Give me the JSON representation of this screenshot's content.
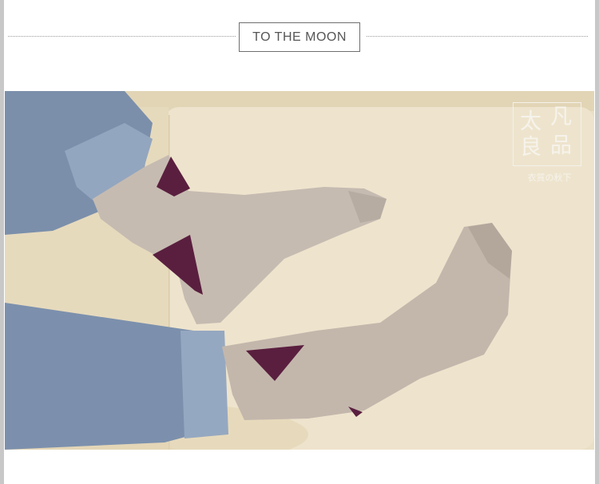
{
  "header": {
    "title": "TO THE MOON"
  },
  "logo": {
    "chars": [
      "太",
      "凡",
      "良",
      "品"
    ],
    "tagline": "衣質の秋下"
  },
  "colors": {
    "sofa": "#e8dcc0",
    "jeans": "#7f93ae",
    "sock": "#c9bdb2",
    "argyle": "#5a1f3f"
  }
}
